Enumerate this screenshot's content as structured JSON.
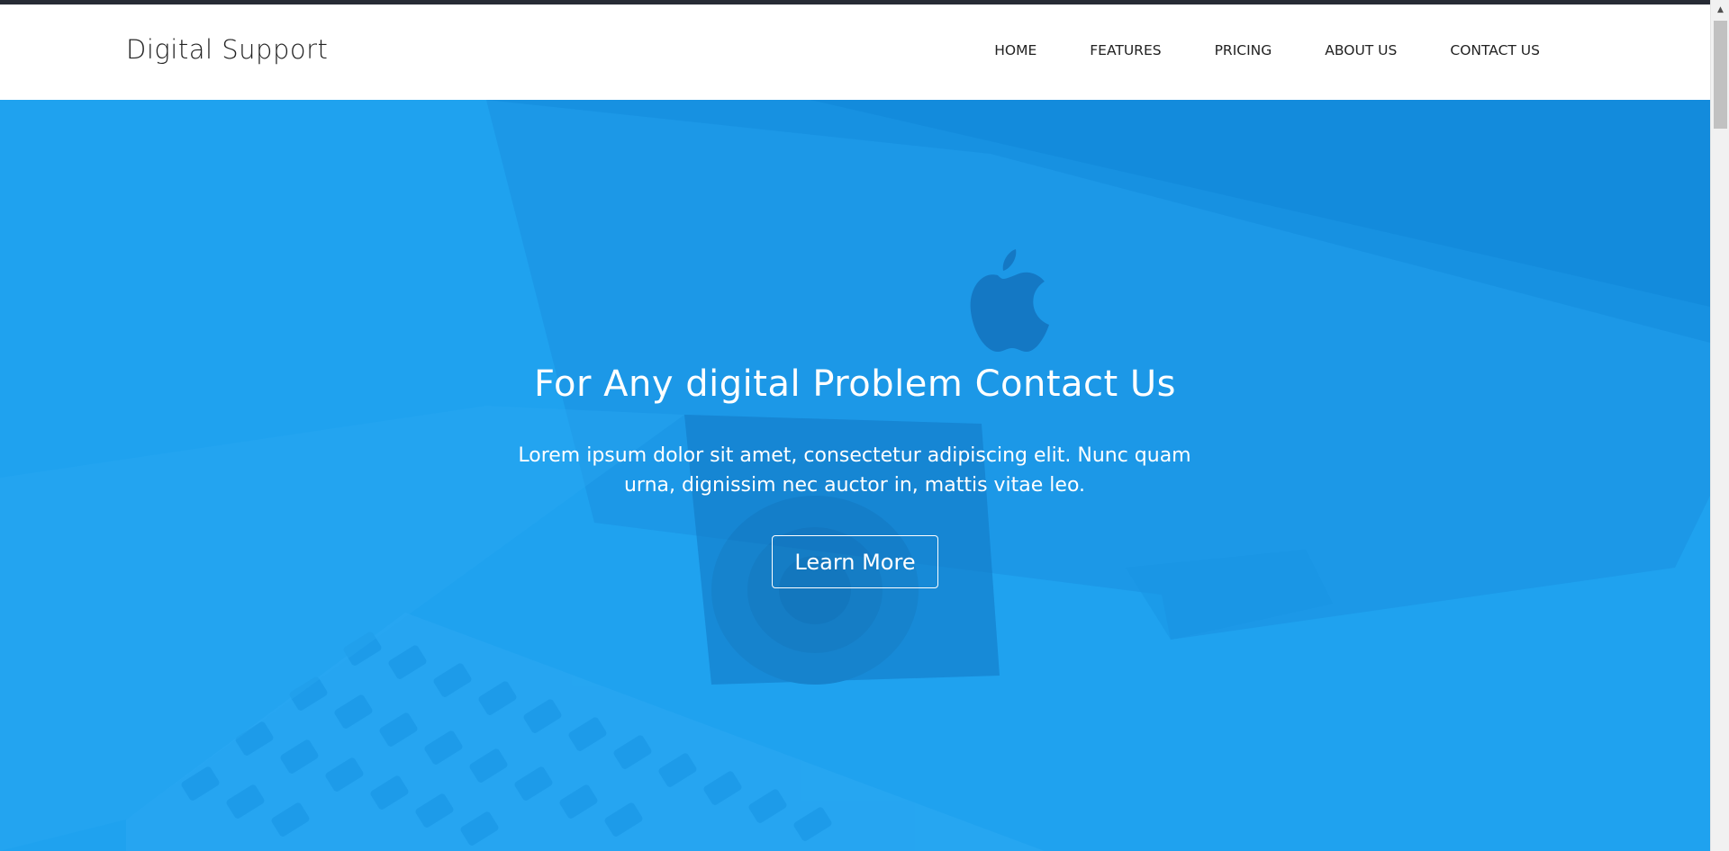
{
  "navbar": {
    "brand": "Digital Support",
    "links": [
      "HOME",
      "FEATURES",
      "PRICING",
      "ABOUT US",
      "CONTACT US"
    ]
  },
  "hero": {
    "title": "For Any digital Problem Contact Us",
    "text": "Lorem ipsum dolor sit amet, consectetur adipiscing elit. Nunc quam urna, dignissim nec auctor in, mattis vitae leo.",
    "button_label": "Learn More",
    "overlay_color": "#1fa2ef"
  },
  "colors": {
    "topbar": "#272b35",
    "nav_text": "#222222",
    "hero_text": "#ffffff"
  },
  "scrollbar": {
    "up_arrow_icon": "triangle-up"
  }
}
